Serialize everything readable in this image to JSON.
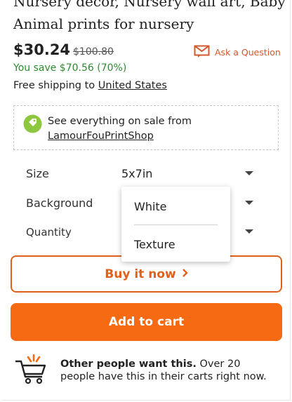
{
  "listing": {
    "title": "Nursery decor, Nursery wall art, Baby Animal prints for nursery"
  },
  "pricing": {
    "price": "$30.24",
    "original_price": "$100.80",
    "savings": "You save $70.56 (70%)"
  },
  "ask_question": {
    "label": "Ask a Question",
    "icon": "mail-icon"
  },
  "shipping": {
    "prefix": "Free shipping to",
    "destination": "United States"
  },
  "sale_banner": {
    "text": "See everything on sale from",
    "shop_name": "LamourFouPrintShop",
    "icon": "tag-icon"
  },
  "options": {
    "size_label": "Size",
    "size_value": "5x7in",
    "background_label": "Background",
    "quantity_label": "Quantity"
  },
  "background_dropdown": {
    "items": [
      "White",
      "Texture"
    ]
  },
  "actions": {
    "buy_now": "Buy it now",
    "add_to_cart": "Add to cart"
  },
  "social_proof": {
    "bold": "Other people want this.",
    "text": "Over 20 people have this in their carts right now.",
    "icon": "cart-icon"
  },
  "colors": {
    "accent_orange": "#f56a12",
    "buy_now_orange": "#e0601c",
    "ask_orange": "#d4582a",
    "savings_green": "#2f8a2f",
    "sale_icon_green": "#8dc63f"
  }
}
